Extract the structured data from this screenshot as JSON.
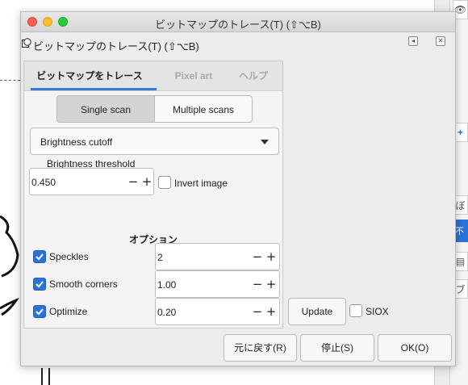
{
  "window": {
    "title": "ビットマップのトレース(T) (⇧⌥B)",
    "dock_title": "ビットマップのトレース(T) (⇧⌥B)"
  },
  "tabs": [
    {
      "label": "ビットマップをトレース",
      "active": true
    },
    {
      "label": "Pixel art",
      "active": false
    },
    {
      "label": "ヘルプ",
      "active": false
    }
  ],
  "scan_mode": {
    "options": [
      "Single scan",
      "Multiple scans"
    ],
    "selected": "Single scan"
  },
  "detection": {
    "mode_selected": "Brightness cutoff",
    "threshold_label": "Brightness threshold",
    "threshold_value": "0.450",
    "invert_label": "Invert image",
    "invert_checked": false
  },
  "options": {
    "title": "オプション",
    "speckles": {
      "label": "Speckles",
      "checked": true,
      "value": "2"
    },
    "smooth_corners": {
      "label": "Smooth corners",
      "checked": true,
      "value": "1.00"
    },
    "optimize": {
      "label": "Optimize",
      "checked": true,
      "value": "0.20"
    }
  },
  "preview": {
    "update_label": "Update",
    "siox_label": "SIOX",
    "siox_checked": false
  },
  "buttons": {
    "reset": "元に戻す(R)",
    "stop": "停止(S)",
    "ok": "OK(O)"
  },
  "spin": {
    "minus": "−",
    "plus": "+"
  },
  "side_panel": {
    "label_1": "ぼ",
    "label_2": "不",
    "label_3": "ブ"
  },
  "colors": {
    "accent": "#2a72d6",
    "tab_underline": "#3a7bd5"
  }
}
